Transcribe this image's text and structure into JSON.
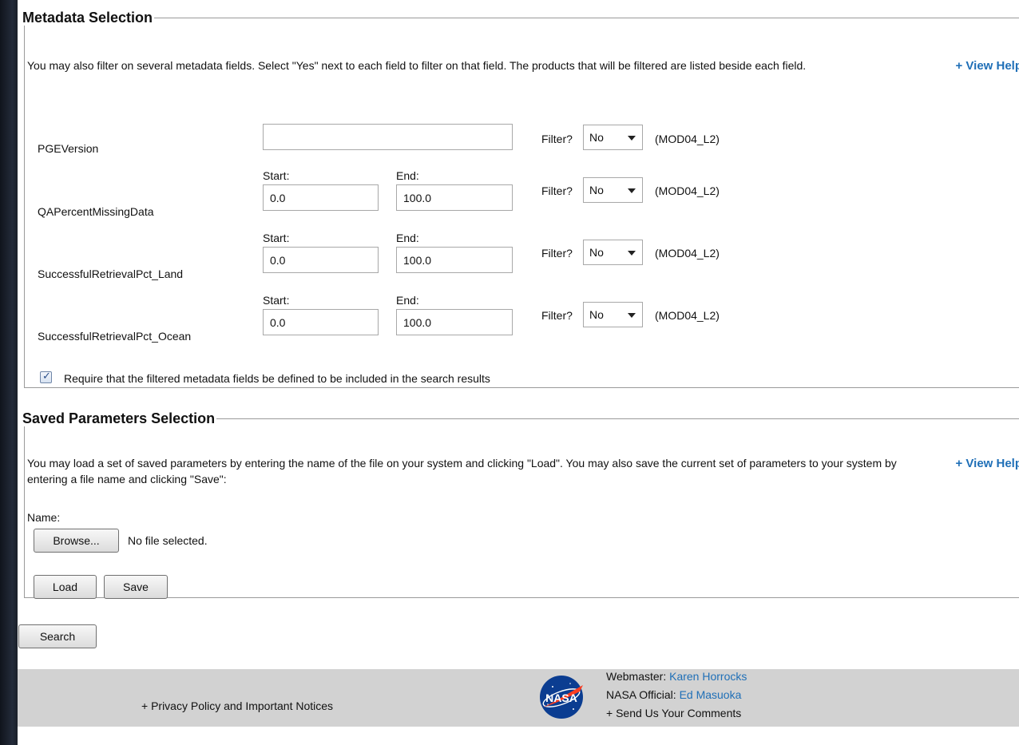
{
  "metadata": {
    "legend": "Metadata Selection",
    "description": "You may also filter on several metadata fields. Select \"Yes\" next to each field to filter on that field. The products that will be filtered are listed beside each field.",
    "view_help": "+ View Help",
    "start_label": "Start:",
    "end_label": "End:",
    "filter_label": "Filter?",
    "fields": [
      {
        "name": "PGEVersion",
        "value": "",
        "filter": "No",
        "product": "(MOD04_L2)"
      },
      {
        "name": "QAPercentMissingData",
        "start": "0.0",
        "end": "100.0",
        "filter": "No",
        "product": "(MOD04_L2)"
      },
      {
        "name": "SuccessfulRetrievalPct_Land",
        "start": "0.0",
        "end": "100.0",
        "filter": "No",
        "product": "(MOD04_L2)"
      },
      {
        "name": "SuccessfulRetrievalPct_Ocean",
        "start": "0.0",
        "end": "100.0",
        "filter": "No",
        "product": "(MOD04_L2)"
      }
    ],
    "require_checkbox": {
      "checked": true,
      "label": "Require that the filtered metadata fields be defined to be included in the search results"
    }
  },
  "saved": {
    "legend": "Saved Parameters Selection",
    "description": "You may load a set of saved parameters by entering the name of the file on your system and clicking \"Load\". You may also save the current set of parameters to your system by entering a file name and clicking \"Save\":",
    "view_help": "+ View Help",
    "name_label": "Name:",
    "browse_label": "Browse...",
    "no_file": "No file selected.",
    "load_label": "Load",
    "save_label": "Save"
  },
  "search_label": "Search",
  "footer": {
    "privacy": "+ Privacy Policy and Important Notices",
    "webmaster_label": "Webmaster:",
    "webmaster_name": "Karen Horrocks",
    "official_label": "NASA Official:",
    "official_name": "Ed Masuoka",
    "comments": "+ Send Us Your Comments",
    "logo_text": "NASA"
  }
}
